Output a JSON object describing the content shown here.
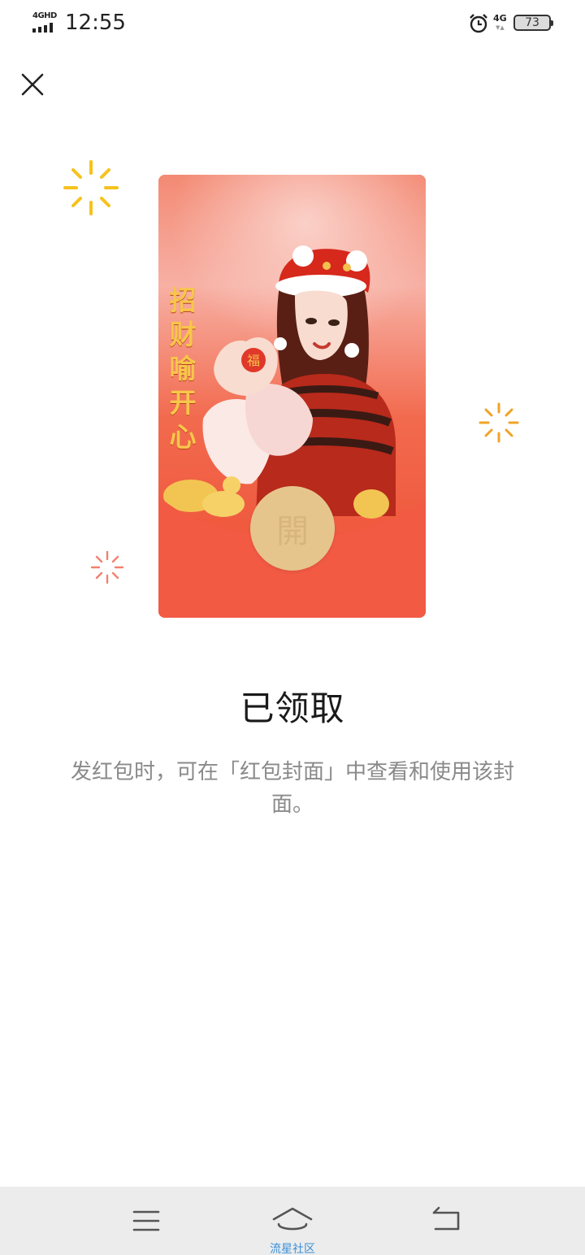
{
  "status_bar": {
    "signal_label": "4GHD",
    "time": "12:55",
    "network_label": "4G",
    "battery_level": "73",
    "icons": [
      "signal-icon",
      "alarm-icon",
      "battery-icon"
    ]
  },
  "header": {
    "close_icon": "close-icon"
  },
  "cover": {
    "slogan": [
      "招",
      "财",
      "喻",
      "开",
      "心"
    ],
    "open_label": "開",
    "colors": {
      "envelope_red": "#f25a44",
      "button_gold": "#e6c58c"
    }
  },
  "main": {
    "title": "已领取",
    "description": "发红包时，可在「红包封面」中查看和使用该封面。"
  },
  "nav_bar": {
    "menu_icon": "menu-icon",
    "home_icon": "home-icon",
    "back_icon": "back-icon",
    "caption": "流星社区"
  }
}
